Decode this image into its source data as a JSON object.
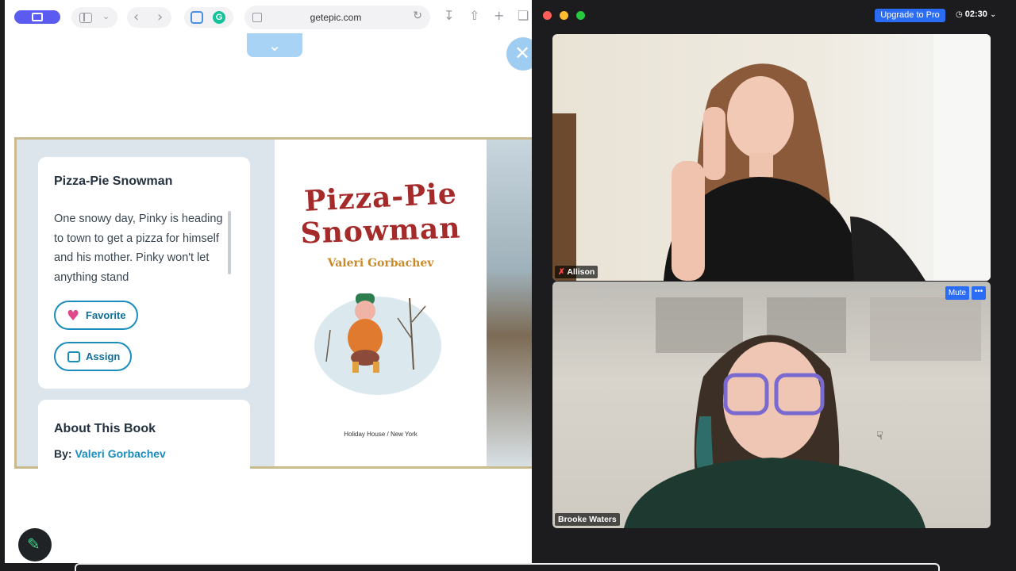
{
  "browser": {
    "url": "getepic.com",
    "icons": [
      "sidebar-icon",
      "back-icon",
      "forward-icon",
      "reload-icon",
      "download-icon",
      "share-icon",
      "new-tab-icon",
      "tabs-overview-icon"
    ]
  },
  "book": {
    "title": "Pizza-Pie Snowman",
    "description": "One snowy day, Pinky is heading to town to get a pizza for himself and his mother. Pinky won't let anything stand",
    "favorite_label": "Favorite",
    "assign_label": "Assign",
    "about_heading": "About This Book",
    "by_label": "By:",
    "author": "Valeri Gorbachev",
    "cover": {
      "title_line1": "Pizza-Pie",
      "title_line2": "Snowman",
      "author": "Valeri Gorbachev",
      "publisher": "Holiday House / New York"
    }
  },
  "zoom": {
    "upgrade_label": "Upgrade to Pro",
    "timer": "02:30",
    "participants": [
      {
        "name": "Allison"
      },
      {
        "name": "Brooke Waters"
      }
    ],
    "mute_label": "Mute",
    "more_label": "•••"
  },
  "colors": {
    "accent": "#1a8dbd",
    "zoom_blue": "#2a6df4",
    "cover_title": "#a52a2a"
  }
}
